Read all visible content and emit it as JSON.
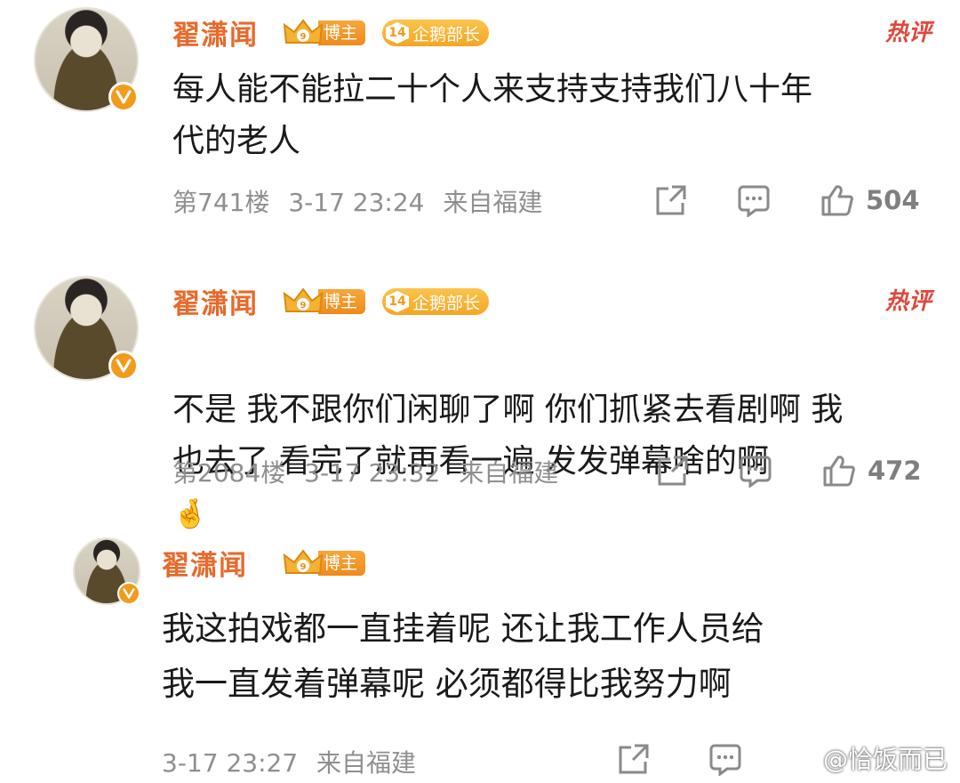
{
  "comments": [
    {
      "username": "翟潇闻",
      "badge_blogger": "博主",
      "badge_level_num": "14",
      "badge_level_label": "企鹅部长",
      "hot_label": "热评",
      "text": "每人能不能拉二十个人来支持支持我们八十年\n代的老人",
      "floor": "第741楼",
      "time": "3-17 23:24",
      "location": "来自福建",
      "likes": "504"
    },
    {
      "username": "翟潇闻",
      "badge_blogger": "博主",
      "badge_level_num": "14",
      "badge_level_label": "企鹅部长",
      "hot_label": "热评",
      "text": "不是 我不跟你们闲聊了啊 你们抓紧去看剧啊 我\n也去了 看完了就再看一遍 发发弹幕啥的啊",
      "emoji": "🤞",
      "floor": "第2084楼",
      "time": "3-17 23:32",
      "location": "来自福建",
      "likes": "472"
    },
    {
      "username": "翟潇闻",
      "badge_blogger": "博主",
      "text": "我这拍戏都一直挂着呢 还让我工作人员给\n我一直发着弹幕呢 必须都得比我努力啊",
      "time": "3-17 23:27",
      "location": "来自福建"
    }
  ],
  "watermark": "@恰饭而已",
  "colors": {
    "username": "#e8692b",
    "hot": "#e0473b",
    "badge": "#f29b1b",
    "meta": "#8f8f8f"
  },
  "icons": [
    "share-icon",
    "reply-icon",
    "like-icon",
    "verified-icon",
    "crown-icon",
    "weibo-logo-icon"
  ]
}
